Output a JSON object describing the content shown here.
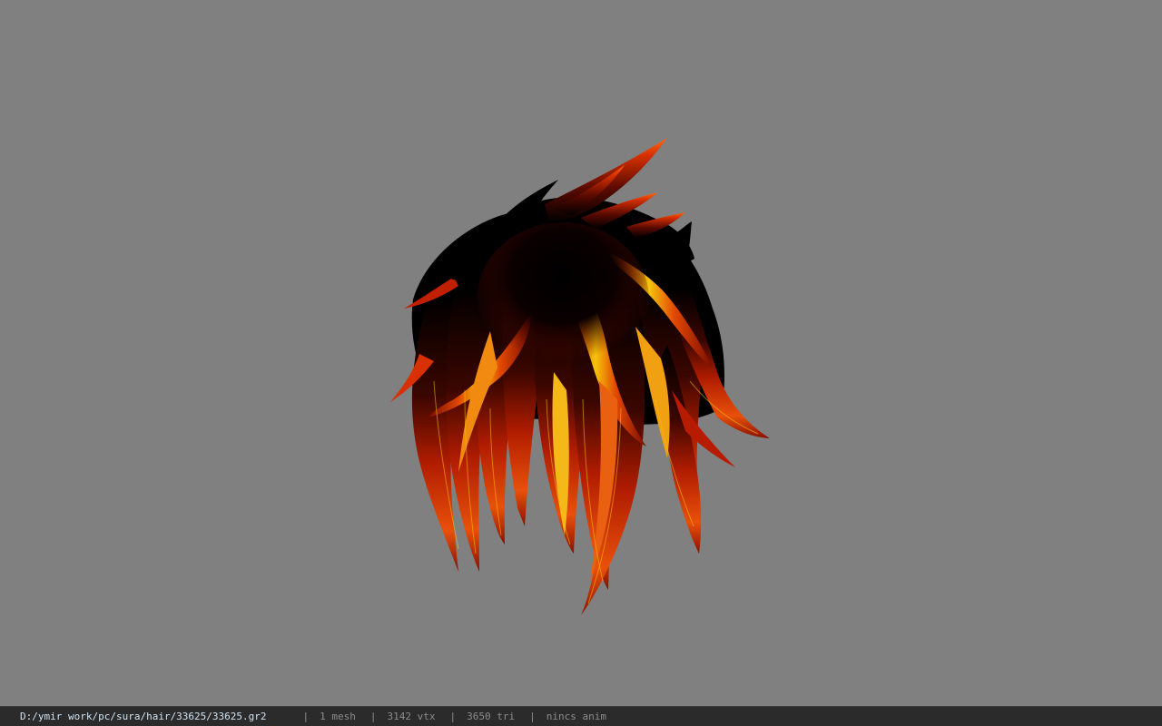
{
  "viewport": {
    "background_color": "#808080",
    "model": {
      "icon": "hair-mesh-model",
      "colors": {
        "root": "#000000",
        "dark_red": "#8a1000",
        "red": "#c82200",
        "orange": "#ee5a00",
        "yellow": "#f6c40a"
      }
    }
  },
  "status_bar": {
    "file_path": "D:/ymir work/pc/sura/hair/33625/33625.gr2",
    "separator": "|",
    "mesh_count": "1 mesh",
    "vertex_count": "3142 vtx",
    "triangle_count": "3650 tri",
    "anim_state": "nincs anim",
    "path_color": "#cfe3f3",
    "text_color": "#8c8c8c",
    "background_color": "#2b2b2b"
  }
}
